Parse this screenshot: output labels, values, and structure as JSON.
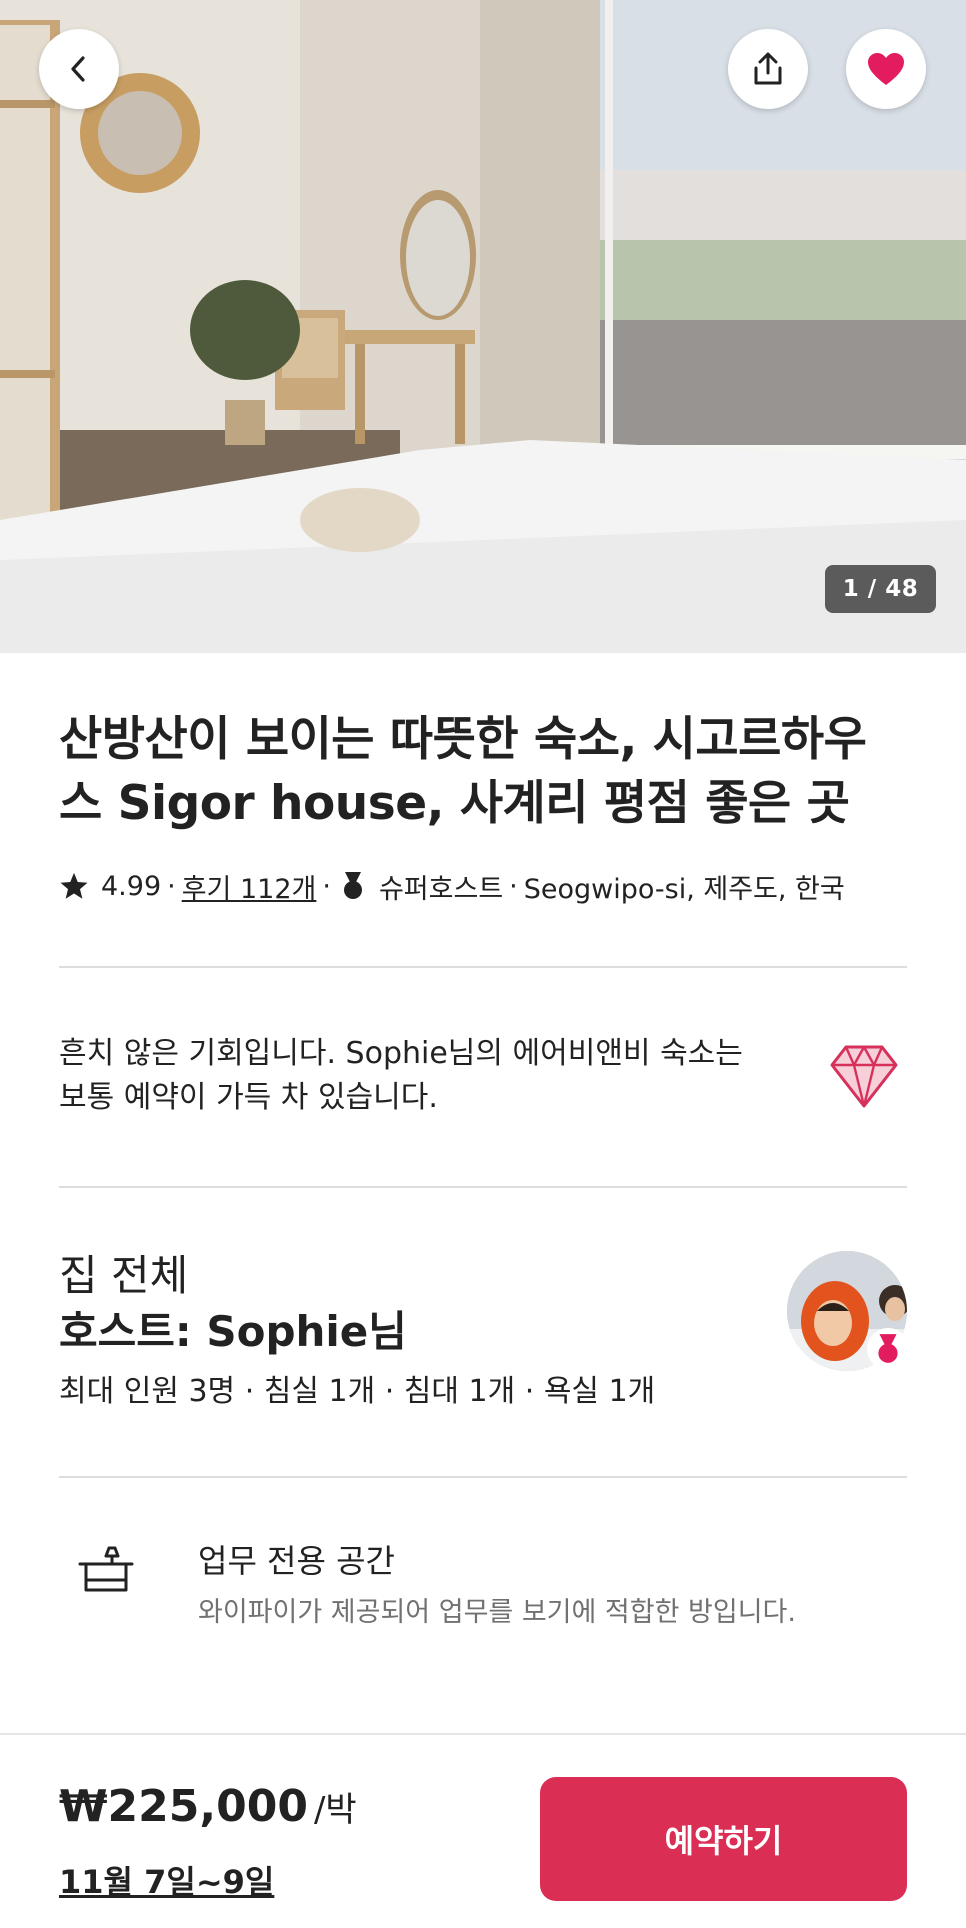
{
  "listing": {
    "photo_counter": "1 / 48",
    "title": "산방산이 보이는 따뜻한 숙소, 시고르하우스 Sigor house, 사계리 평점 좋은 곳",
    "rating": "4.99",
    "reviews": "후기 112개",
    "superhost": "슈퍼호스트",
    "location": "Seogwipo-si, 제주도, 한국",
    "separator": "·"
  },
  "rare_find": {
    "text": "흔치 않은 기회입니다. Sophie님의 에어비앤비 숙소는 보통 예약이 가득 차 있습니다.",
    "icon": "diamond-icon"
  },
  "host": {
    "type": "집 전체",
    "name": "호스트: Sophie님",
    "details": "최대 인원 3명 · 침실 1개 · 침대 1개 · 욕실 1개"
  },
  "feature": {
    "icon": "desk-icon",
    "title": "업무 전용 공간",
    "description": "와이파이가 제공되어 업무를 보기에 적합한 방입니다."
  },
  "booking": {
    "price": "₩225,000",
    "per_night": "/박",
    "dates": "11월 7일~9일",
    "reserve_label": "예약하기"
  },
  "colors": {
    "accent": "#da2e54",
    "favorite": "#e31c5f",
    "diamond": "#d7305a"
  }
}
